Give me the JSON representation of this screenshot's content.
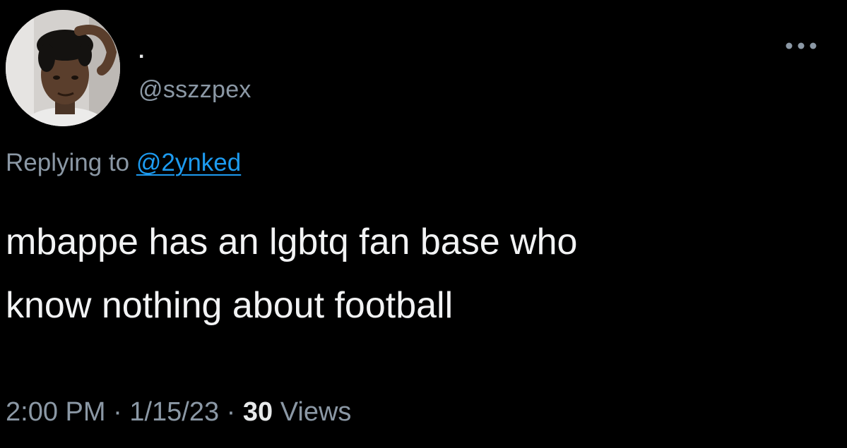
{
  "user": {
    "display_name": ".",
    "handle": "@sszzpex"
  },
  "reply": {
    "prefix": "Replying to ",
    "mention": "@2ynked"
  },
  "tweet": {
    "text": "mbappe has an lgbtq fan base who\nknow nothing about football"
  },
  "meta": {
    "time": "2:00 PM",
    "separator": " · ",
    "date": "1/15/23",
    "views_count": "30",
    "views_label": " Views"
  },
  "icons": {
    "more": "more-horizontal-icon",
    "avatar": "profile-photo"
  },
  "colors": {
    "background": "#000000",
    "primary_text": "#e7e9ea",
    "secondary_text": "#8b98a5",
    "link": "#1d9bf0"
  }
}
